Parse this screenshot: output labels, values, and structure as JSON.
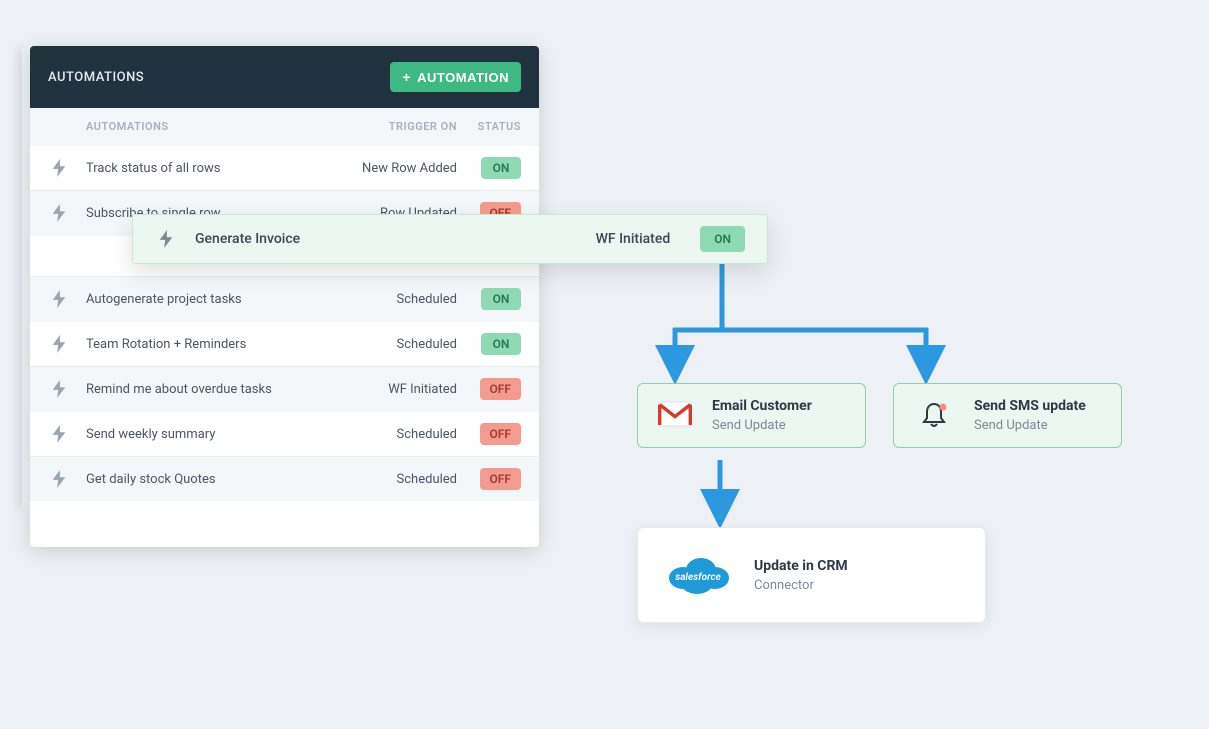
{
  "panel": {
    "title": "AUTOMATIONS",
    "new_button_label": "AUTOMATION",
    "columns": {
      "name": "AUTOMATIONS",
      "trigger": "TRIGGER ON",
      "status": "STATUS"
    },
    "rows": [
      {
        "name": "Track status of all rows",
        "trigger": "New Row Added",
        "status": "ON"
      },
      {
        "name": "Subscribe to single row",
        "trigger": "Row Updated",
        "status": "OFF"
      },
      {
        "name": "Autogenerate project tasks",
        "trigger": "Scheduled",
        "status": "ON"
      },
      {
        "name": "Team Rotation + Reminders",
        "trigger": "Scheduled",
        "status": "ON"
      },
      {
        "name": "Remind me about overdue tasks",
        "trigger": "WF Initiated",
        "status": "OFF"
      },
      {
        "name": "Send weekly summary",
        "trigger": "Scheduled",
        "status": "OFF"
      },
      {
        "name": "Get daily stock Quotes",
        "trigger": "Scheduled",
        "status": "OFF"
      }
    ]
  },
  "highlighted": {
    "name": "Generate Invoice",
    "trigger": "WF Initiated",
    "status": "ON"
  },
  "flow": {
    "email": {
      "title": "Email Customer",
      "sub": "Send Update"
    },
    "sms": {
      "title": "Send SMS update",
      "sub": "Send Update"
    },
    "crm": {
      "title": "Update in CRM",
      "sub": "Connector"
    },
    "salesforce_label": "salesforce"
  },
  "colors": {
    "accent_green": "#3fb984",
    "connector_blue": "#2c98e0"
  }
}
